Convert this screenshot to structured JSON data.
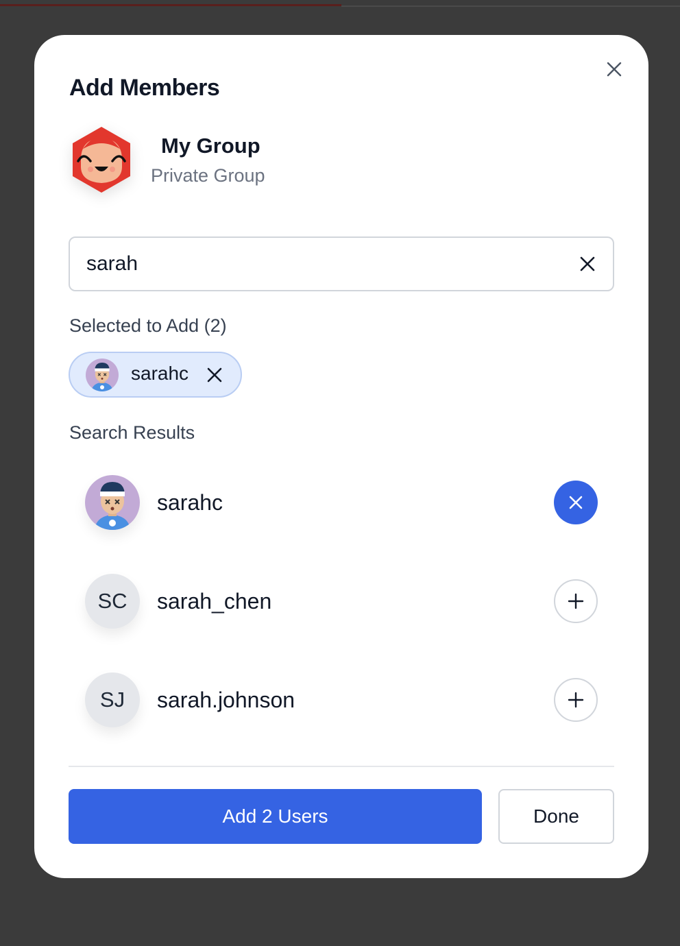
{
  "modal": {
    "title": "Add Members",
    "close_icon": "close-icon"
  },
  "group": {
    "name": "My Group",
    "type": "Private Group",
    "avatar_icon": "smiling-hexagon-avatar",
    "avatar_color": "#e2372d"
  },
  "search": {
    "value": "sarah",
    "placeholder": "",
    "clear_icon": "close-icon"
  },
  "selected": {
    "label": "Selected to Add (2)",
    "chips": [
      {
        "label": "sarahc",
        "remove_icon": "close-icon"
      }
    ]
  },
  "results": {
    "label": "Search Results",
    "items": [
      {
        "name": "sarahc",
        "avatar": "illustrated-user-avatar",
        "initials": "",
        "state": "selected",
        "action_icon": "close-icon"
      },
      {
        "name": "sarah_chen",
        "avatar": "initials",
        "initials": "SC",
        "state": "unselected",
        "action_icon": "plus-icon"
      },
      {
        "name": "sarah.johnson",
        "avatar": "initials",
        "initials": "SJ",
        "state": "unselected",
        "action_icon": "plus-icon"
      }
    ]
  },
  "footer": {
    "primary_label": "Add 2 Users",
    "secondary_label": "Done"
  },
  "colors": {
    "accent": "#3563e3",
    "chip_bg": "#e1ebfd",
    "backdrop": "#3b3b3b"
  }
}
